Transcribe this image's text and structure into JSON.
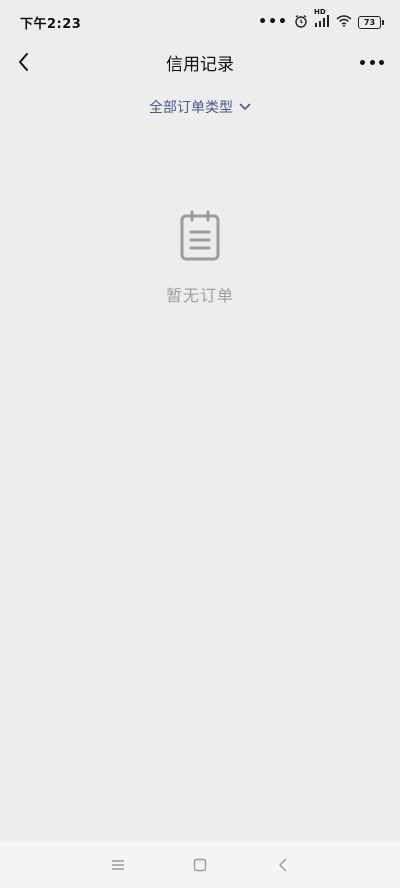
{
  "status_bar": {
    "time": "下午2:23",
    "dots": "•••",
    "hd_label": "HD",
    "battery_level": "73"
  },
  "header": {
    "title": "信用记录",
    "back_icon": "chevron-left-icon",
    "more_icon": "more-horizontal-icon"
  },
  "filter": {
    "label": "全部订单类型",
    "icon": "chevron-down-icon",
    "color": "#4a5a88"
  },
  "empty_state": {
    "icon": "clipboard-icon",
    "text": "暂无订单",
    "color": "#a0a0a0"
  },
  "system_nav": {
    "menu_icon": "menu-icon",
    "home_icon": "square-icon",
    "back_icon": "triangle-back-icon"
  },
  "colors": {
    "background": "#ededed",
    "nav_bar_background": "#f5f5f5"
  }
}
